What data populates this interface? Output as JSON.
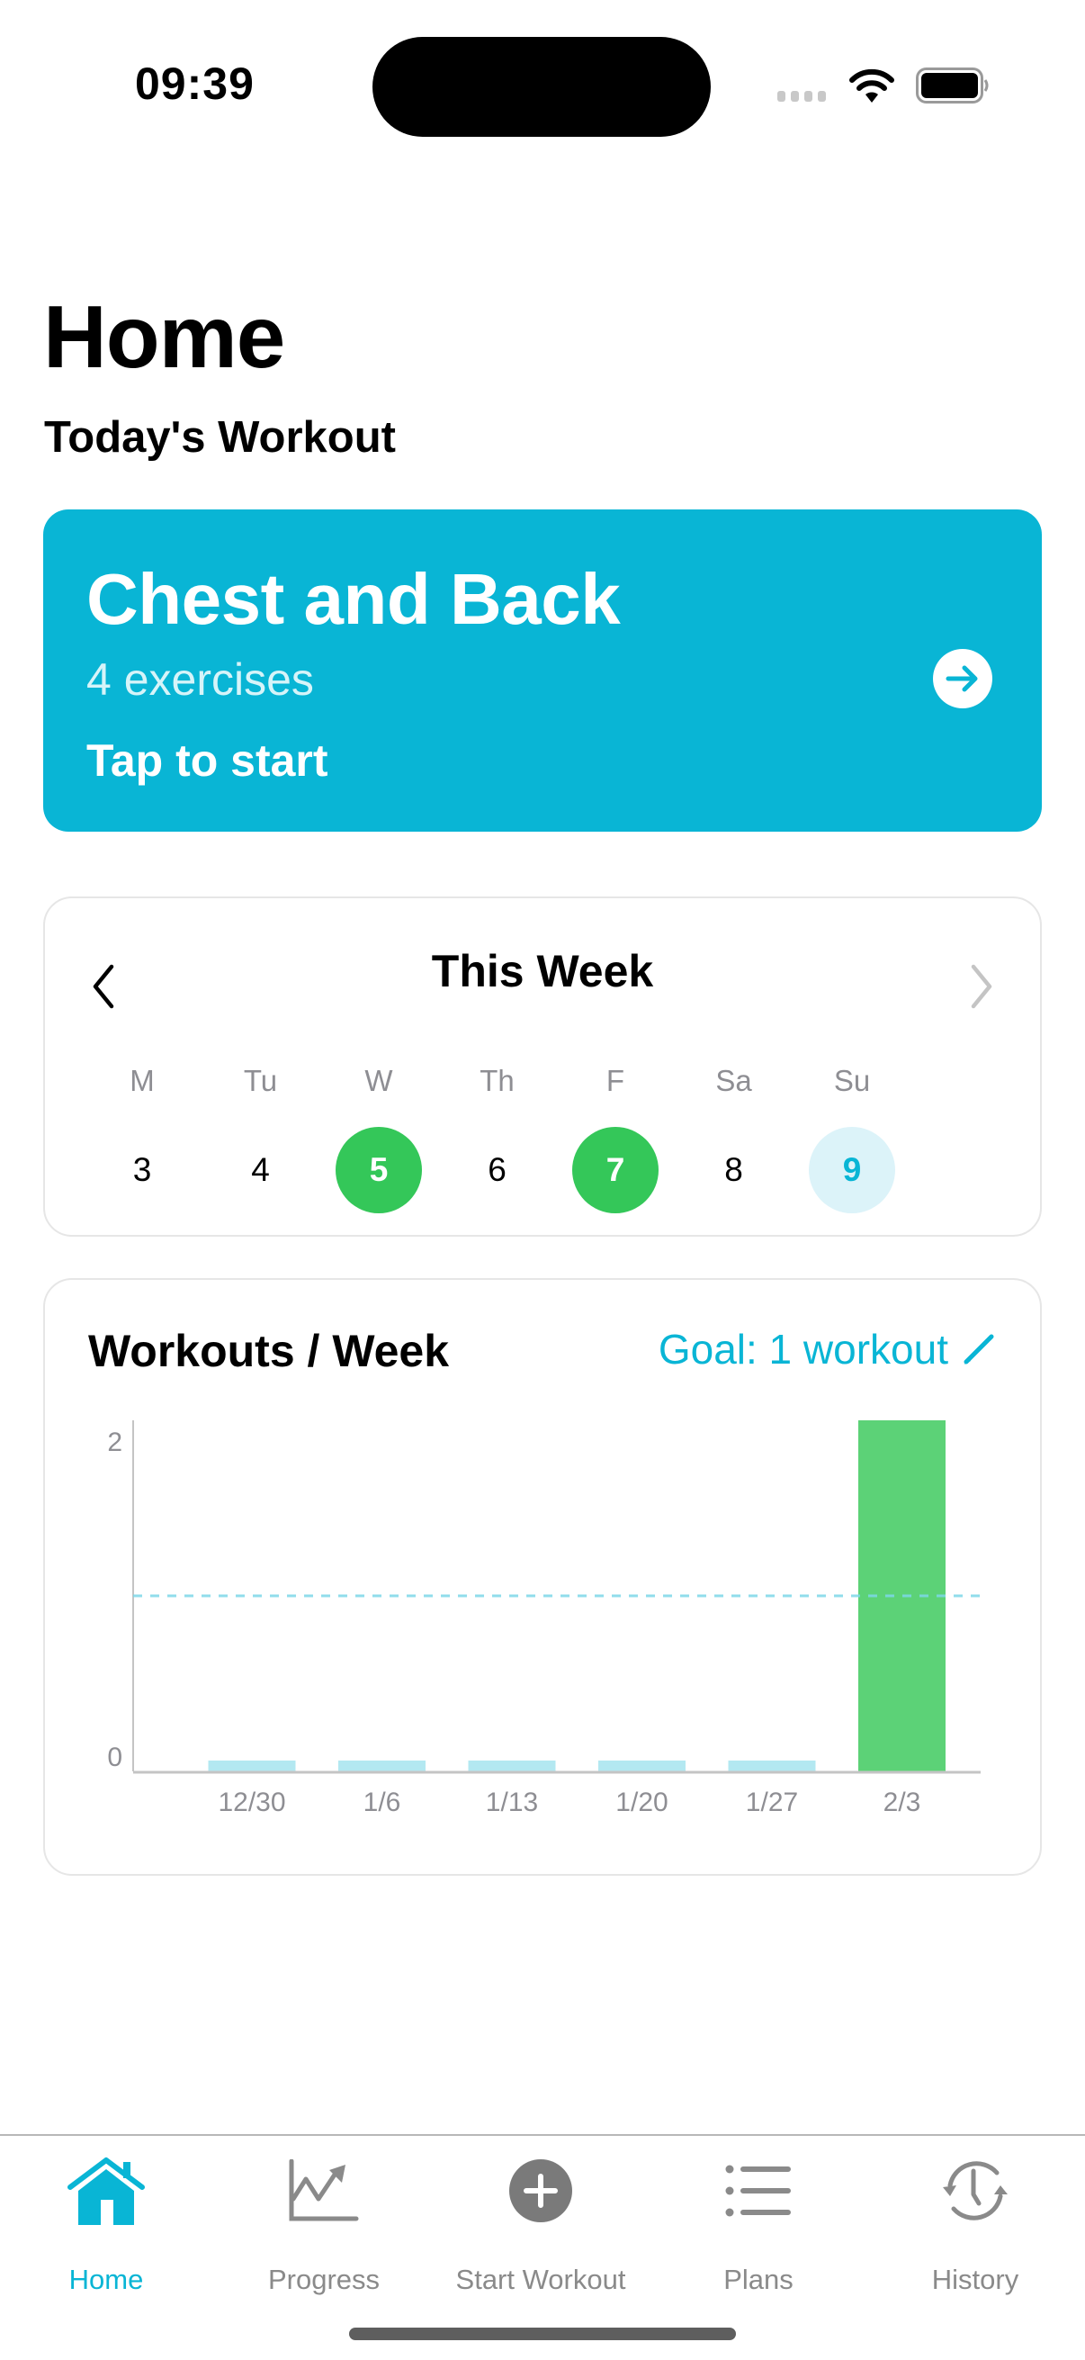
{
  "status_bar": {
    "time": "09:39",
    "icons": [
      "cellular-signal-icon",
      "wifi-icon",
      "battery-icon"
    ]
  },
  "header": {
    "title": "Home",
    "section_title": "Today's Workout"
  },
  "workout_card": {
    "name": "Chest and Back",
    "exercise_count": "4 exercises",
    "cta": "Tap to start",
    "icon": "arrow-right-circle-icon",
    "color": "#09b5d5"
  },
  "week": {
    "title": "This Week",
    "prev_icon": "chevron-left-icon",
    "next_icon": "chevron-right-icon",
    "days": [
      {
        "label": "M",
        "date": "3",
        "state": "none"
      },
      {
        "label": "Tu",
        "date": "4",
        "state": "none"
      },
      {
        "label": "W",
        "date": "5",
        "state": "done"
      },
      {
        "label": "Th",
        "date": "6",
        "state": "none"
      },
      {
        "label": "F",
        "date": "7",
        "state": "done"
      },
      {
        "label": "Sa",
        "date": "8",
        "state": "none"
      },
      {
        "label": "Su",
        "date": "9",
        "state": "today"
      }
    ],
    "colors": {
      "done": "#34c759",
      "today_bg": "#dcf3f9",
      "today_text": "#09b5d5"
    }
  },
  "chart_card": {
    "title": "Workouts / Week",
    "goal_label": "Goal: 1 workout",
    "goal_icon": "pencil-icon"
  },
  "chart_data": {
    "type": "bar",
    "title": "Workouts / Week",
    "xlabel": "",
    "ylabel": "",
    "categories": [
      "12/30",
      "1/6",
      "1/13",
      "1/20",
      "1/27",
      "2/3"
    ],
    "values": [
      0,
      0,
      0,
      0,
      0,
      2
    ],
    "ylim": [
      0,
      2
    ],
    "yticks": [
      "0",
      "2"
    ],
    "goal": 1,
    "goal_line_style": "dashed",
    "colors": {
      "met": "#5cd277",
      "empty": "#b3e8f1",
      "goal_line": "#7dd8e8",
      "axis": "#c4c4c4"
    },
    "grid": false,
    "legend": "none"
  },
  "tab_bar": {
    "tabs": [
      {
        "label": "Home",
        "icon": "house-icon",
        "active": true
      },
      {
        "label": "Progress",
        "icon": "chart-line-icon",
        "active": false
      },
      {
        "label": "Start Workout",
        "icon": "plus-circle-icon",
        "active": false
      },
      {
        "label": "Plans",
        "icon": "list-icon",
        "active": false
      },
      {
        "label": "History",
        "icon": "history-clock-icon",
        "active": false
      }
    ],
    "active_color": "#09b5d5",
    "inactive_color": "#8a8a8a"
  }
}
